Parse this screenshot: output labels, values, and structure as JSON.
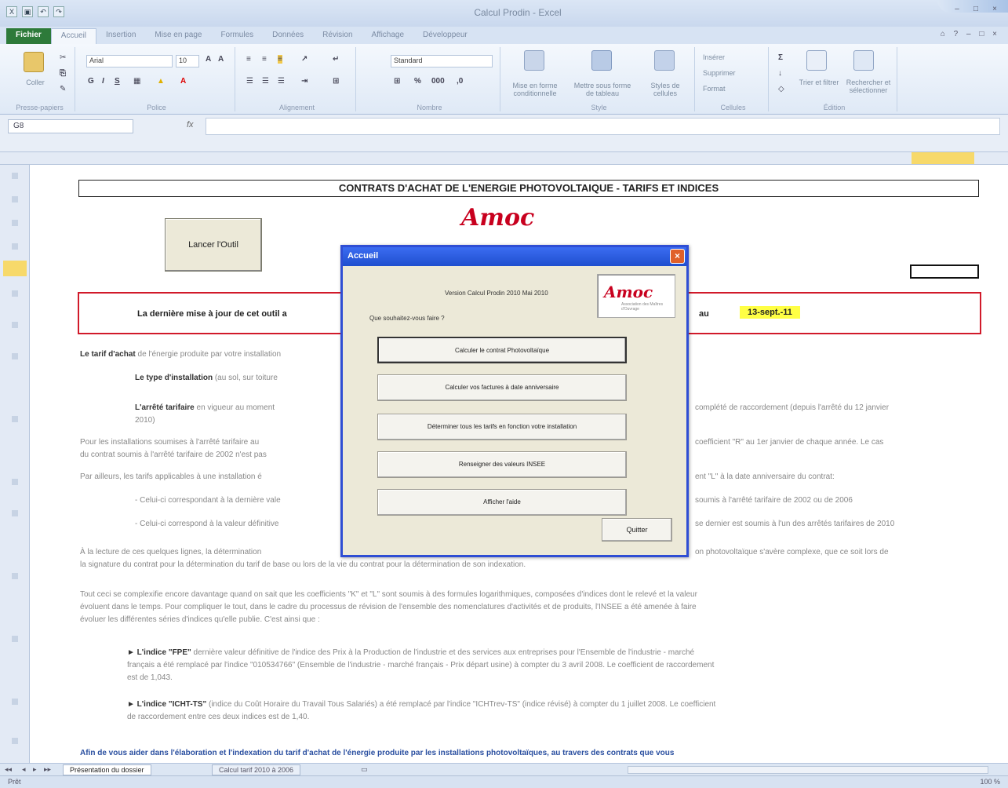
{
  "window": {
    "title": "Calcul Prodin - Excel",
    "quick_access": [
      "save",
      "undo",
      "redo"
    ],
    "controls": [
      "–",
      "□",
      "×"
    ]
  },
  "ribbon": {
    "tabs": [
      "Fichier",
      "Accueil",
      "Insertion",
      "Mise en page",
      "Formules",
      "Données",
      "Révision",
      "Affichage",
      "Développeur"
    ],
    "active_tab": 1,
    "help": "⌂ ? – □ ×",
    "groups": [
      "Presse-papiers",
      "Police",
      "Alignement",
      "Nombre",
      "Style",
      "Cellules",
      "Édition"
    ],
    "font_name": "Arial",
    "font_size": "10",
    "number_format": "Standard",
    "buttons": {
      "paste": "Coller",
      "cond_format": "Mise en forme conditionnelle",
      "table_format": "Mettre sous forme de tableau",
      "cell_styles": "Styles de cellules",
      "insert": "Insérer",
      "delete": "Supprimer",
      "format": "Format",
      "sort": "Trier et filtrer",
      "find": "Rechercher et sélectionner"
    }
  },
  "formula_bar": {
    "name_box": "G8",
    "fx": "fx",
    "value": ""
  },
  "sheet": {
    "title": "CONTRATS D'ACHAT DE L'ENERGIE PHOTOVOLTAIQUE - TARIFS ET INDICES",
    "launch_button": "Lancer l'Outil",
    "logo": "Amoc",
    "update_text": "La dernière mise à jour de cet outil a",
    "update_au": "au",
    "update_date": "13-sept.-11",
    "paragraphs": [
      {
        "bold": "Le tarif d'achat",
        "text": " de l'énergie produite par votre installation"
      },
      {
        "bold": "Le type d'installation",
        "text": " (au sol, sur toiture"
      },
      {
        "bold": "L'arrêté tarifaire",
        "text": " en vigueur au moment",
        "tail": "complété de raccordement (depuis l'arrêté du 12 janvier"
      },
      {
        "bold": "",
        "text": "2010)"
      },
      {
        "bold": "",
        "text": "Pour les installations soumises à l'arrêté tarifaire au",
        "tail": "coefficient \"R\" au 1er janvier de chaque année. Le cas"
      },
      {
        "bold": "",
        "text": "du contrat soumis à l'arrêté tarifaire de 2002 n'est pas"
      },
      {
        "bold": "",
        "text": "Par ailleurs, les tarifs applicables à une installation é",
        "tail": "ent \"L\" à la date anniversaire du contrat:"
      },
      {
        "bold": "",
        "text": "- Celui-ci correspondant à la dernière vale",
        "tail": "soumis à l'arrêté tarifaire de 2002 ou de 2006"
      },
      {
        "bold": "",
        "text": "- Celui-ci correspond à la valeur définitive",
        "tail": "se dernier est soumis à l'un des arrêtés tarifaires de 2010"
      },
      {
        "bold": "",
        "text": "À la lecture de ces quelques lignes, la détermination",
        "tail": "on photovoltaïque s'avère complexe, que ce soit lors de"
      },
      {
        "bold": "",
        "text": "la signature du contrat pour la détermination du tarif de base ou lors de la vie du contrat pour la détermination de son indexation."
      },
      {
        "bold": "",
        "text": "Tout ceci se complexifie encore davantage quand on sait que les coefficients \"K\" et \"L\" sont soumis à des formules logarithmiques, composées d'indices dont le relevé et la valeur"
      },
      {
        "bold": "",
        "text": "évoluent dans le temps. Pour compliquer le tout, dans le cadre du processus de révision de l'ensemble des nomenclatures d'activités et de produits, l'INSEE a été amenée à faire"
      },
      {
        "bold": "",
        "text": "évoluer les différentes séries d'indices qu'elle publie. C'est ainsi que :"
      },
      {
        "bold": "► L'indice \"FPE\"",
        "text": " dernière valeur définitive de l'indice des Prix à la Production de l'industrie et des services aux entreprises pour l'Ensemble de l'industrie - marché"
      },
      {
        "bold": "",
        "text": "français a été remplacé par l'indice \"010534766\" (Ensemble de l'industrie - marché français - Prix départ usine) à compter du 3 avril 2008. Le coefficient de raccordement"
      },
      {
        "bold": "",
        "text": "est de 1,043."
      },
      {
        "bold": "► L'indice \"ICHT-TS\"",
        "text": " (indice du Coût Horaire du Travail Tous Salariés) a été remplacé par l'indice \"ICHTrev-TS\" (indice révisé) à compter du 1 juillet 2008. Le coefficient"
      },
      {
        "bold": "",
        "text": "de raccordement entre ces deux indices est de 1,40."
      },
      {
        "bold": "",
        "text": "Afin de vous aider dans l'élaboration et l'indexation du tarif d'achat de l'énergie produite par les installations photovoltaïques, au travers des contrats que vous"
      }
    ]
  },
  "dialog": {
    "title": "Accueil",
    "close": "×",
    "version": "Version Calcul Prodin 2010 Mai 2010",
    "prompt": "Que souhaitez-vous faire ?",
    "logo": "Amoc",
    "logo_sub": "Association des Maîtres d'Ouvrage",
    "buttons": [
      "Calculer le contrat Photovoltaïque",
      "Calculer vos factures à date anniversaire",
      "Déterminer tous les tarifs en fonction votre installation",
      "Renseigner des valeurs INSEE",
      "Afficher l'aide"
    ],
    "quit": "Quitter"
  },
  "sheet_tabs": [
    "Présentation du dossier",
    "Calcul tarif 2010 à 2006"
  ],
  "status": {
    "text": "Prêt",
    "zoom": "100 %"
  },
  "colors": {
    "accent": "#2f4ed4",
    "file_tab": "#2d7a3a",
    "highlight": "#ffff44",
    "frame_red": "#d11a2a",
    "logo_red": "#c8001e"
  }
}
